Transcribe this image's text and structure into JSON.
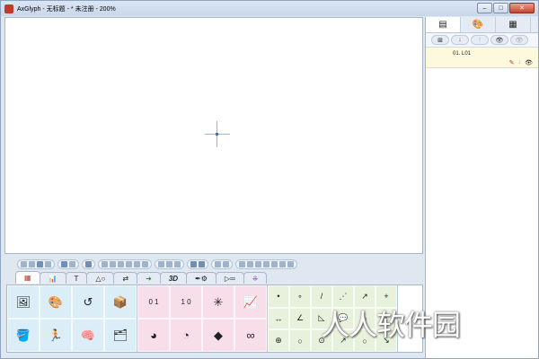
{
  "window": {
    "title": "AxGlyph - 无标题 - * 未注册 - 200%"
  },
  "layers_panel": {
    "tabs": [
      "layers",
      "palette",
      "scenes"
    ],
    "toolbar": [
      "add-layer",
      "move-down",
      "move-up",
      "show",
      "hide"
    ],
    "layers": [
      {
        "name": "01. L01"
      }
    ]
  },
  "toolbar_groups": 12,
  "category_tabs": [
    {
      "icon": "shapes-icon"
    },
    {
      "icon": "chart-icon"
    },
    {
      "label": "T"
    },
    {
      "icon": "triangle-circle-icon"
    },
    {
      "icon": "flow-icon"
    },
    {
      "icon": "arrow-icon"
    },
    {
      "label": "3D"
    },
    {
      "icon": "pen-gear-icon"
    },
    {
      "icon": "dimension-icon"
    },
    {
      "icon": "grid-icon"
    }
  ],
  "palette": {
    "group1": [
      "🖼",
      "🎨",
      "↺",
      "📦",
      "🪣",
      "🏃",
      "🧠",
      "🗂"
    ],
    "group2": [
      "0 1",
      "1 0",
      "✳",
      "📈",
      "◕",
      "◔",
      "◆",
      "∞"
    ],
    "group3": [
      "•",
      "∘",
      "/",
      "⋰",
      "↗",
      "+",
      "↔",
      "∠",
      "◺",
      "💬",
      "○",
      "↕",
      "⊕",
      "○",
      "⊙",
      "↗",
      "○",
      "↘"
    ]
  },
  "watermark": "人人软件园"
}
